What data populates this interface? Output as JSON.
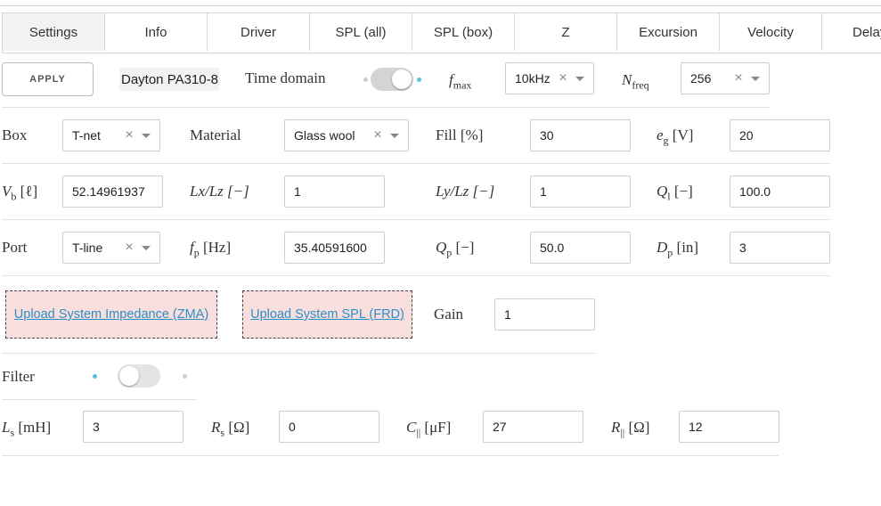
{
  "tabs": [
    "Settings",
    "Info",
    "Driver",
    "SPL (all)",
    "SPL (box)",
    "Z",
    "Excursion",
    "Velocity",
    "Delay"
  ],
  "top": {
    "apply_label": "APPLY",
    "driver_name": "Dayton PA310-8",
    "time_domain_label": "Time domain",
    "fmax_label_sym": "f",
    "fmax_label_sub": "max",
    "fmax_value": "10kHz",
    "nfreq_label_sym": "N",
    "nfreq_label_sub": "freq",
    "nfreq_value": "256"
  },
  "box_row": {
    "box_label": "Box",
    "box_value": "T-net",
    "material_label": "Material",
    "material_value": "Glass wool",
    "fill_label": "Fill [%]",
    "fill_value": "30",
    "eg_sym": "e",
    "eg_sub": "g",
    "eg_unit": " [V]",
    "eg_value": "20"
  },
  "vol_row": {
    "vb_sym": "V",
    "vb_sub": "b",
    "vb_unit": " [ℓ]",
    "vb_value": "52.14961937",
    "lxlz_label": "Lx/Lz [−]",
    "lxlz_value": "1",
    "lylz_label": "Ly/Lz [−]",
    "lylz_value": "1",
    "ql_sym": "Q",
    "ql_sub": "l",
    "ql_unit": " [−]",
    "ql_value": "100.0"
  },
  "port_row": {
    "port_label": "Port",
    "port_value": "T-line",
    "fp_sym": "f",
    "fp_sub": "p",
    "fp_unit": " [Hz]",
    "fp_value": "35.40591600",
    "qp_sym": "Q",
    "qp_sub": "p",
    "qp_unit": " [−]",
    "qp_value": "50.0",
    "dp_sym": "D",
    "dp_sub": "p",
    "dp_unit": " [in]",
    "dp_value": "3"
  },
  "upload_row": {
    "zma_label": "Upload System Impedance (ZMA)",
    "frd_label": "Upload System SPL (FRD)",
    "gain_label": "Gain",
    "gain_value": "1"
  },
  "filter_row": {
    "filter_label": "Filter"
  },
  "filter_params": {
    "ls_sym": "L",
    "ls_sub": "s",
    "ls_unit": " [mH]",
    "ls_value": "3",
    "rs_sym": "R",
    "rs_sub": "s",
    "rs_unit": " [Ω]",
    "rs_value": "0",
    "cp_sym": "C",
    "cp_sub": "||",
    "cp_unit": " [μF]",
    "cp_value": "27",
    "rp_sym": "R",
    "rp_sub": "||",
    "rp_unit": " [Ω]",
    "rp_value": "12"
  },
  "colors": {
    "accent": "#5bc0de",
    "upload_bg": "#f9dede",
    "link": "#2a8fc9"
  }
}
